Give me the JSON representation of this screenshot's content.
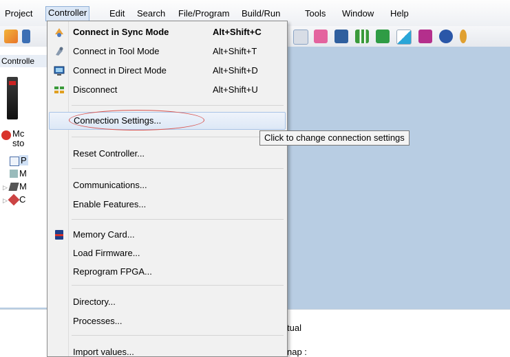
{
  "menubar": {
    "items": [
      "Project",
      "Controller",
      "Edit",
      "Search",
      "File/Program",
      "Build/Run",
      "Tools",
      "Window",
      "Help"
    ]
  },
  "left_panel": {
    "title": "Controlle",
    "status_lines": [
      "Mc",
      "sto"
    ],
    "tree": [
      "P",
      "M",
      "M",
      "C"
    ]
  },
  "bottom": {
    "text_1": "tual",
    "text_2": "nap :"
  },
  "controller_menu": {
    "items": [
      {
        "label": "Connect in Sync Mode",
        "shortcut": "Alt+Shift+C",
        "icon": "connect-sync-icon"
      },
      {
        "label": "Connect in Tool Mode",
        "shortcut": "Alt+Shift+T",
        "icon": "connect-tool-icon"
      },
      {
        "label": "Connect in Direct Mode",
        "shortcut": "Alt+Shift+D",
        "icon": "connect-direct-icon"
      },
      {
        "label": "Disconnect",
        "shortcut": "Alt+Shift+U",
        "icon": "disconnect-icon"
      },
      {
        "label": "Connection Settings..."
      },
      {
        "label": "Reset Controller..."
      },
      {
        "label": "Communications..."
      },
      {
        "label": "Enable Features..."
      },
      {
        "label": "Memory Card...",
        "icon": "memory-card-icon"
      },
      {
        "label": "Load Firmware..."
      },
      {
        "label": "Reprogram FPGA..."
      },
      {
        "label": "Directory..."
      },
      {
        "label": "Processes..."
      },
      {
        "label": "Import values..."
      }
    ]
  },
  "tooltip": {
    "text": "Click to change connection settings"
  },
  "colors": {
    "workspace": "#b8cde3",
    "highlight": "#d9534f",
    "menu_bg": "#f1f1f1"
  }
}
